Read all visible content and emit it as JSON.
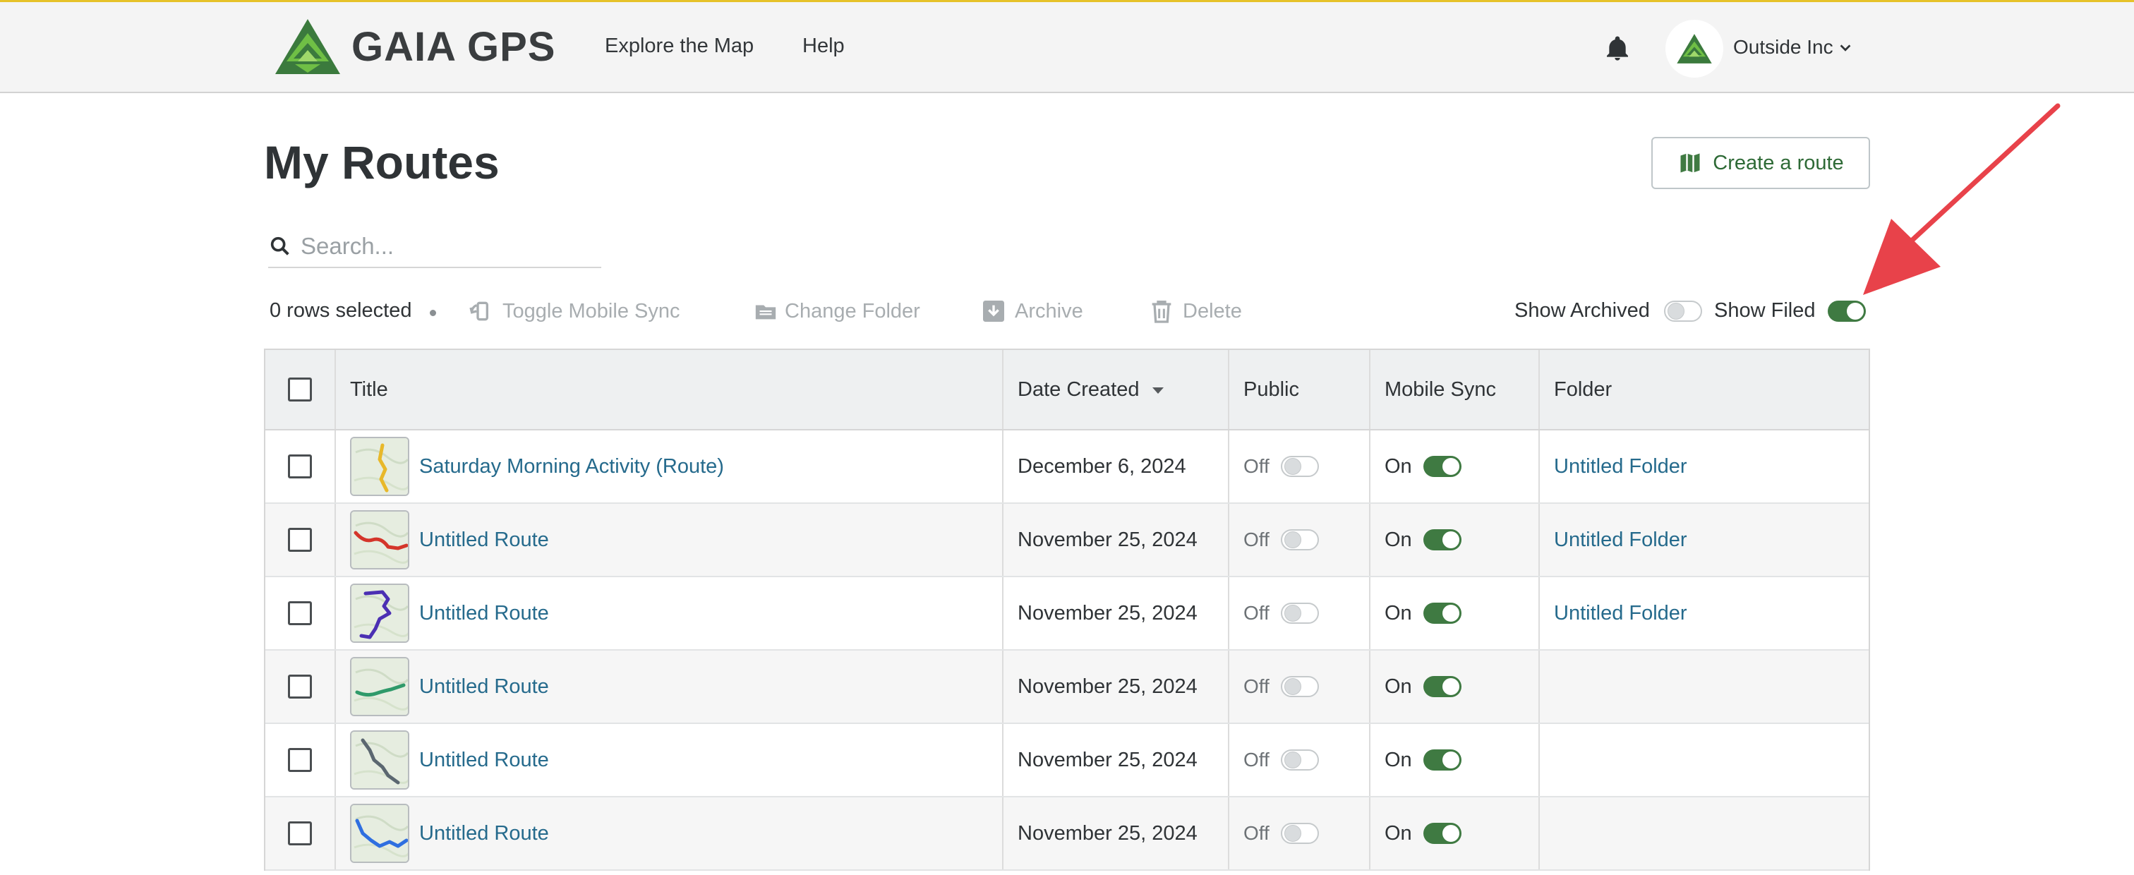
{
  "header": {
    "logo_text": "GAIA GPS",
    "nav": [
      {
        "label": "Explore the Map"
      },
      {
        "label": "Help"
      }
    ],
    "account_name": "Outside Inc",
    "icons": {
      "bell": "bell-icon",
      "chevron": "chevron-down-icon"
    }
  },
  "page": {
    "title": "My Routes",
    "create_button_label": "Create a route",
    "search_placeholder": "Search..."
  },
  "toolbar": {
    "rows_selected": "0 rows selected",
    "actions": [
      {
        "label": "Toggle Mobile Sync",
        "icon": "mobile-sync-icon"
      },
      {
        "label": "Change Folder",
        "icon": "folder-icon"
      },
      {
        "label": "Archive",
        "icon": "archive-icon"
      },
      {
        "label": "Delete",
        "icon": "trash-icon"
      }
    ],
    "show_archived_label": "Show Archived",
    "show_archived": false,
    "show_filed_label": "Show Filed",
    "show_filed": true
  },
  "table": {
    "columns": {
      "title": "Title",
      "date_created": "Date Created",
      "public": "Public",
      "mobile_sync": "Mobile Sync",
      "folder": "Folder"
    },
    "sorted_by": "Date Created",
    "rows": [
      {
        "title": "Saturday Morning Activity (Route)",
        "date": "December 6, 2024",
        "public": "Off",
        "public_on": false,
        "sync": "On",
        "sync_on": true,
        "folder": "Untitled Folder",
        "route_color": "#e8b82a"
      },
      {
        "title": "Untitled Route",
        "date": "November 25, 2024",
        "public": "Off",
        "public_on": false,
        "sync": "On",
        "sync_on": true,
        "folder": "Untitled Folder",
        "route_color": "#d4352a"
      },
      {
        "title": "Untitled Route",
        "date": "November 25, 2024",
        "public": "Off",
        "public_on": false,
        "sync": "On",
        "sync_on": true,
        "folder": "Untitled Folder",
        "route_color": "#4b2fb3"
      },
      {
        "title": "Untitled Route",
        "date": "November 25, 2024",
        "public": "Off",
        "public_on": false,
        "sync": "On",
        "sync_on": true,
        "folder": "",
        "route_color": "#2f9a6a"
      },
      {
        "title": "Untitled Route",
        "date": "November 25, 2024",
        "public": "Off",
        "public_on": false,
        "sync": "On",
        "sync_on": true,
        "folder": "",
        "route_color": "#5b6770"
      },
      {
        "title": "Untitled Route",
        "date": "November 25, 2024",
        "public": "Off",
        "public_on": false,
        "sync": "On",
        "sync_on": true,
        "folder": "",
        "route_color": "#2f6fe0"
      }
    ]
  },
  "colors": {
    "brand_green": "#3f7a42",
    "link_blue": "#256a8c",
    "annotation_arrow": "#e8424a",
    "top_accent": "#e6c229"
  }
}
